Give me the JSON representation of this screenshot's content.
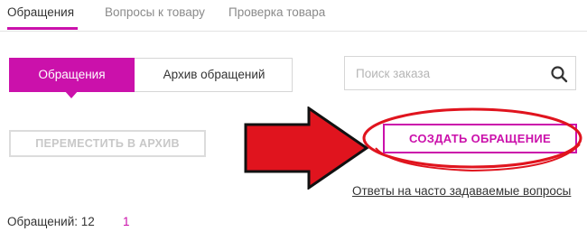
{
  "tabs": [
    {
      "label": "Обращения",
      "active": true
    },
    {
      "label": "Вопросы к товару",
      "active": false
    },
    {
      "label": "Проверка товара",
      "active": false
    }
  ],
  "segmented": {
    "active_label": "Обращения",
    "archive_label": "Архив обращений"
  },
  "search": {
    "placeholder": "Поиск заказа",
    "value": "",
    "icon": "search-icon"
  },
  "actions": {
    "move_to_archive": "ПЕРЕМЕСТИТЬ В АРХИВ",
    "create_request": "СОЗДАТЬ ОБРАЩЕНИЕ",
    "faq_link": "Ответы на часто задаваемые вопросы"
  },
  "summary": {
    "count_label": "Обращений: 12",
    "page": "1"
  },
  "colors": {
    "accent": "#cb11ab",
    "annotation_red": "#e0141e",
    "disabled": "#c8c8c8"
  }
}
